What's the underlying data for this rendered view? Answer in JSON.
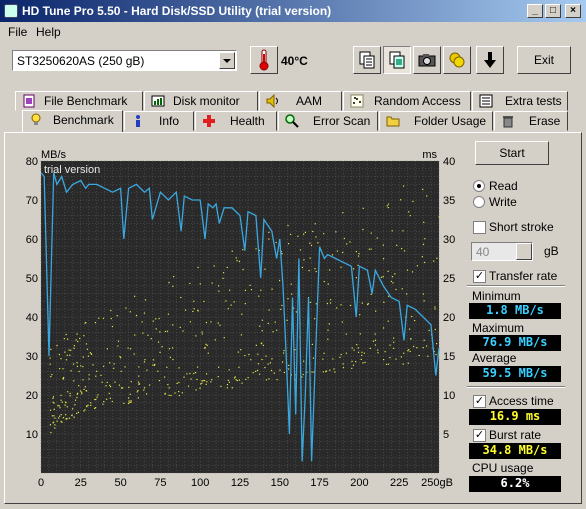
{
  "window": {
    "title": "HD Tune Pro 5.50 - Hard Disk/SSD Utility (trial version)"
  },
  "menu": {
    "file": "File",
    "help": "Help"
  },
  "toolbar": {
    "drive": "ST3250620AS (250 gB)",
    "temperature": "40°C",
    "exit_label": "Exit",
    "icons": [
      "thermometer-icon",
      "copy-text-icon",
      "copy-screenshot-icon",
      "camera-icon",
      "coins-icon",
      "download-arrow-icon"
    ]
  },
  "tabs_top": [
    {
      "label": "File Benchmark",
      "icon": "file-benchmark-icon"
    },
    {
      "label": "Disk monitor",
      "icon": "disk-monitor-icon"
    },
    {
      "label": "AAM",
      "icon": "speaker-icon"
    },
    {
      "label": "Random Access",
      "icon": "random-access-icon"
    },
    {
      "label": "Extra tests",
      "icon": "extra-tests-icon"
    }
  ],
  "tabs_bottom": [
    {
      "label": "Benchmark",
      "icon": "lightbulb-icon",
      "active": true
    },
    {
      "label": "Info",
      "icon": "info-icon"
    },
    {
      "label": "Health",
      "icon": "health-cross-icon"
    },
    {
      "label": "Error Scan",
      "icon": "magnifier-icon"
    },
    {
      "label": "Folder Usage",
      "icon": "folder-icon"
    },
    {
      "label": "Erase",
      "icon": "trash-icon"
    }
  ],
  "controls": {
    "start": "Start",
    "read": "Read",
    "write": "Write",
    "short_stroke": "Short stroke",
    "short_stroke_value": "40",
    "short_stroke_unit": "gB",
    "transfer_rate": "Transfer rate",
    "access_time": "Access time",
    "burst_rate": "Burst rate",
    "cpu_usage": "CPU usage"
  },
  "stats": {
    "minimum_label": "Minimum",
    "minimum": "1.8 MB/s",
    "maximum_label": "Maximum",
    "maximum": "76.9 MB/s",
    "average_label": "Average",
    "average": "59.5 MB/s",
    "access_time": "16.9 ms",
    "burst_rate": "34.8 MB/s",
    "cpu_usage": "6.2%"
  },
  "chart_data": {
    "type": "line",
    "watermark": "trial version",
    "ylabel_left": "MB/s",
    "ylabel_right": "ms",
    "xlabel_unit": "gB",
    "x_ticks": [
      "0",
      "25",
      "50",
      "75",
      "100",
      "125",
      "150",
      "175",
      "200",
      "225",
      "250gB"
    ],
    "y_left_ticks": [
      "80",
      "70",
      "60",
      "50",
      "40",
      "30",
      "20",
      "10"
    ],
    "y_right_ticks": [
      "40",
      "35",
      "30",
      "25",
      "20",
      "15",
      "10",
      "5"
    ],
    "xlim": [
      0,
      250
    ],
    "ylim_left": [
      0,
      80
    ],
    "ylim_right": [
      0,
      40
    ],
    "colors": {
      "transfer": "#3aa8e0",
      "access": "#e8e84a",
      "background": "#2a2a2a",
      "grid": "#606060"
    },
    "series": [
      {
        "name": "Transfer rate",
        "axis": "left",
        "x": [
          0,
          2,
          5,
          8,
          10,
          13,
          16,
          20,
          25,
          28,
          30,
          35,
          40,
          45,
          50,
          52,
          55,
          60,
          65,
          68,
          70,
          75,
          80,
          85,
          88,
          90,
          95,
          100,
          103,
          105,
          108,
          110,
          112,
          115,
          120,
          125,
          128,
          130,
          135,
          138,
          140,
          145,
          148,
          150,
          152,
          154,
          156,
          158,
          160,
          162,
          164,
          166,
          168,
          170,
          172,
          175,
          178,
          180,
          185,
          190,
          195,
          198,
          200,
          205,
          208,
          210,
          215,
          220,
          225,
          228,
          230,
          235,
          240,
          245,
          248,
          250
        ],
        "y": [
          77,
          76,
          30,
          77,
          74,
          76,
          72,
          74,
          75,
          73,
          74,
          74,
          73,
          72,
          73,
          60,
          73,
          74,
          72,
          73,
          65,
          72,
          70,
          72,
          62,
          71,
          70,
          70,
          60,
          69,
          68,
          69,
          64,
          68,
          68,
          66,
          57,
          67,
          66,
          50,
          65,
          62,
          55,
          60,
          48,
          30,
          10,
          45,
          15,
          55,
          3,
          20,
          45,
          3,
          25,
          58,
          55,
          56,
          55,
          54,
          53,
          40,
          53,
          52,
          46,
          52,
          48,
          45,
          44,
          34,
          43,
          42,
          40,
          38,
          25,
          32
        ]
      },
      {
        "name": "Access time",
        "axis": "right",
        "pattern": "scatter-band",
        "x": [
          5,
          10,
          15,
          20,
          25,
          30,
          40,
          50,
          60,
          70,
          80,
          90,
          100,
          110,
          120,
          130,
          140,
          150,
          160,
          170,
          180,
          190,
          200,
          210,
          220,
          230,
          240,
          250
        ],
        "y_min": [
          5,
          6,
          7,
          7,
          8,
          8,
          9,
          9,
          9,
          10,
          10,
          10,
          11,
          11,
          11,
          12,
          12,
          12,
          12,
          13,
          13,
          13,
          14,
          14,
          14,
          14,
          15,
          15
        ],
        "y_max": [
          16,
          17,
          18,
          18,
          19,
          20,
          21,
          22,
          23,
          24,
          25,
          26,
          27,
          28,
          29,
          30,
          31,
          32,
          33,
          33,
          34,
          35,
          36,
          37,
          37,
          38,
          38,
          38
        ]
      }
    ]
  }
}
